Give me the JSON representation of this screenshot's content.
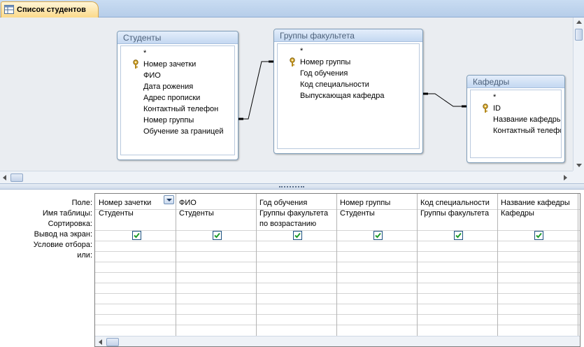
{
  "tab": {
    "label": "Список студентов",
    "icon": "query-icon"
  },
  "tables": [
    {
      "title": "Студенты",
      "fields": [
        "*",
        "Номер зачетки",
        "ФИО",
        "Дата рожения",
        "Адрес прописки",
        "Контактный телефон",
        "Номер группы",
        "Обучение за границей"
      ],
      "primary_key": "Номер зачетки"
    },
    {
      "title": "Группы факультета",
      "fields": [
        "*",
        "Номер группы",
        "Год обучения",
        "Код специальности",
        "Выпускающая кафедра"
      ],
      "primary_key": "Номер группы"
    },
    {
      "title": "Кафедры",
      "fields": [
        "*",
        "ID",
        "Название кафедры",
        "Контактный телефон"
      ],
      "primary_key": "ID"
    }
  ],
  "grid": {
    "row_labels": [
      "Поле:",
      "Имя таблицы:",
      "Сортировка:",
      "Вывод на экран:",
      "Условие отбора:",
      "или:"
    ],
    "columns": [
      {
        "field": "Номер зачетки",
        "table": "Студенты",
        "sort": "",
        "show": true
      },
      {
        "field": "ФИО",
        "table": "Студенты",
        "sort": "",
        "show": true
      },
      {
        "field": "Год обучения",
        "table": "Группы факультета",
        "sort": "по возрастанию",
        "show": true
      },
      {
        "field": "Номер группы",
        "table": "Студенты",
        "sort": "",
        "show": true
      },
      {
        "field": "Код специальности",
        "table": "Группы факультета",
        "sort": "",
        "show": true
      },
      {
        "field": "Название кафедры",
        "table": "Кафедры",
        "sort": "",
        "show": true
      }
    ]
  },
  "colors": {
    "tab_bg": "#fbd98a",
    "tab_bar": "#c9dcf2",
    "diagram_bg": "#eaedf1",
    "table_header": "#c4d8f1",
    "checkbox_check": "#1f9c2a"
  }
}
